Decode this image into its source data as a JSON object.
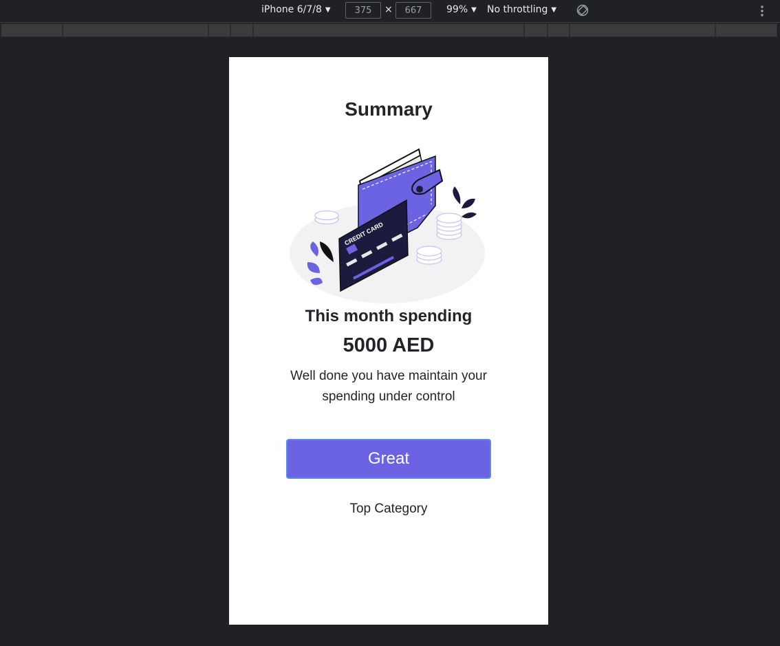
{
  "devtools": {
    "device": "iPhone 6/7/8",
    "width": "375",
    "height": "667",
    "dimension_separator": "×",
    "zoom": "99%",
    "throttling": "No throttling",
    "caret": "▼",
    "icons": [
      "rotate-icon",
      "more-options-icon"
    ]
  },
  "app": {
    "title": "Summary",
    "subtitle": "This month spending",
    "amount": "5000 AED",
    "message": "Well done you have maintain your spending under control",
    "primary_button": "Great",
    "link": "Top Category",
    "illustration_text": "CREDIT CARD",
    "colors": {
      "accent": "#6c63e3",
      "button_border": "#5b8bf0",
      "card": "#1c1a3d",
      "text": "#212529",
      "devtools_bg": "#202124"
    }
  }
}
